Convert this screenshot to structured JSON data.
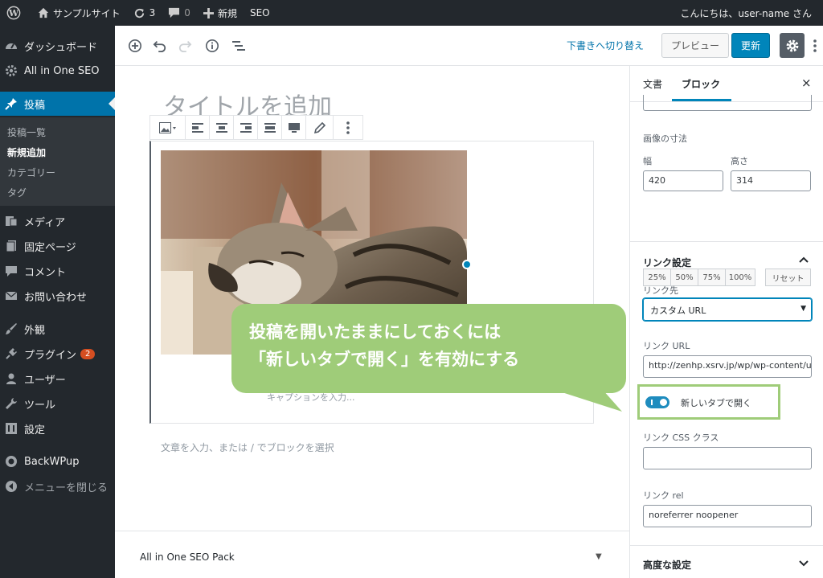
{
  "admin_bar": {
    "site_name": "サンプルサイト",
    "updates_count": "3",
    "comments_count": "0",
    "new_label": "新規",
    "seo_label": "SEO",
    "greeting": "こんにちは、user-name さん"
  },
  "sidebar": {
    "items": [
      {
        "label": "ダッシュボード",
        "icon": "dashboard-icon"
      },
      {
        "label": "All in One SEO",
        "icon": "gear-icon"
      },
      {
        "label": "投稿",
        "icon": "pin-icon"
      },
      {
        "label": "メディア",
        "icon": "media-icon"
      },
      {
        "label": "固定ページ",
        "icon": "page-icon"
      },
      {
        "label": "コメント",
        "icon": "comment-icon"
      },
      {
        "label": "お問い合わせ",
        "icon": "mail-icon"
      },
      {
        "label": "外観",
        "icon": "brush-icon"
      },
      {
        "label": "プラグイン",
        "icon": "plugin-icon",
        "badge": "2"
      },
      {
        "label": "ユーザー",
        "icon": "user-icon"
      },
      {
        "label": "ツール",
        "icon": "wrench-icon"
      },
      {
        "label": "設定",
        "icon": "settings-icon"
      },
      {
        "label": "BackWPup",
        "icon": "backwpup-icon"
      },
      {
        "label": "メニューを閉じる",
        "icon": "collapse-icon"
      }
    ],
    "submenu": [
      "投稿一覧",
      "新規追加",
      "カテゴリー",
      "タグ"
    ]
  },
  "toolbar": {
    "draft_switch": "下書きへ切り替え",
    "preview": "プレビュー",
    "update": "更新"
  },
  "editor": {
    "title_placeholder": "タイトルを追加",
    "caption_placeholder": "キャプションを入力...",
    "paragraph_placeholder": "文章を入力、または / でブロックを選択",
    "metabox_title": "All in One SEO Pack"
  },
  "panel": {
    "tab_document": "文書",
    "tab_block": "ブロック",
    "close": "×",
    "image_size_label": "画像の寸法",
    "width_label": "幅",
    "height_label": "高さ",
    "width_value": "420",
    "height_value": "314",
    "percent_buttons": [
      "25%",
      "50%",
      "75%",
      "100%"
    ],
    "reset": "リセット",
    "link_settings": "リンク設定",
    "link_target_label": "リンク先",
    "link_target_value": "カスタム URL",
    "link_url_label": "リンク URL",
    "link_url_value": "http://zenhp.xsrv.jp/wp/wp-content/u",
    "new_tab_label": "新しいタブで開く",
    "new_tab_enabled": true,
    "css_class_label": "リンク CSS クラス",
    "css_class_value": "",
    "rel_label": "リンク rel",
    "rel_value": "noreferrer noopener",
    "advanced": "高度な設定"
  },
  "callout": {
    "line1": "投稿を開いたままにしておくには",
    "line2": "「新しいタブで開く」を有効にする",
    "color": "#9fcc79"
  },
  "colors": {
    "admin_dark": "#23282d",
    "accent_blue": "#0073aa",
    "button_blue": "#0085ba"
  }
}
